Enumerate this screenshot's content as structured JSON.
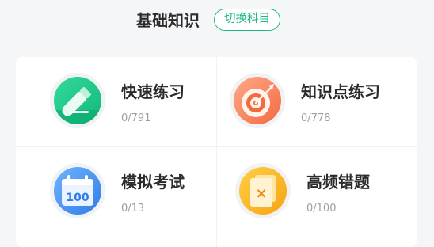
{
  "header": {
    "title": "基础知识",
    "switch_label": "切换科目"
  },
  "tiles": [
    {
      "name": "快速练习",
      "progress": "0/791",
      "icon": "pencil-icon",
      "color": "#1fbf86"
    },
    {
      "name": "知识点练习",
      "progress": "0/778",
      "icon": "target-icon",
      "color": "#f47a4c"
    },
    {
      "name": "模拟考试",
      "progress": "0/13",
      "icon": "calendar-icon",
      "icon_text": "100",
      "color": "#3d8cf0"
    },
    {
      "name": "高频错题",
      "progress": "0/100",
      "icon": "wrong-questions-icon",
      "icon_text": "×",
      "color": "#f9b21c"
    }
  ],
  "colors": {
    "accent": "#1fb884",
    "background": "#f4f6f8",
    "card": "#ffffff",
    "muted_text": "#9a9ea6"
  }
}
